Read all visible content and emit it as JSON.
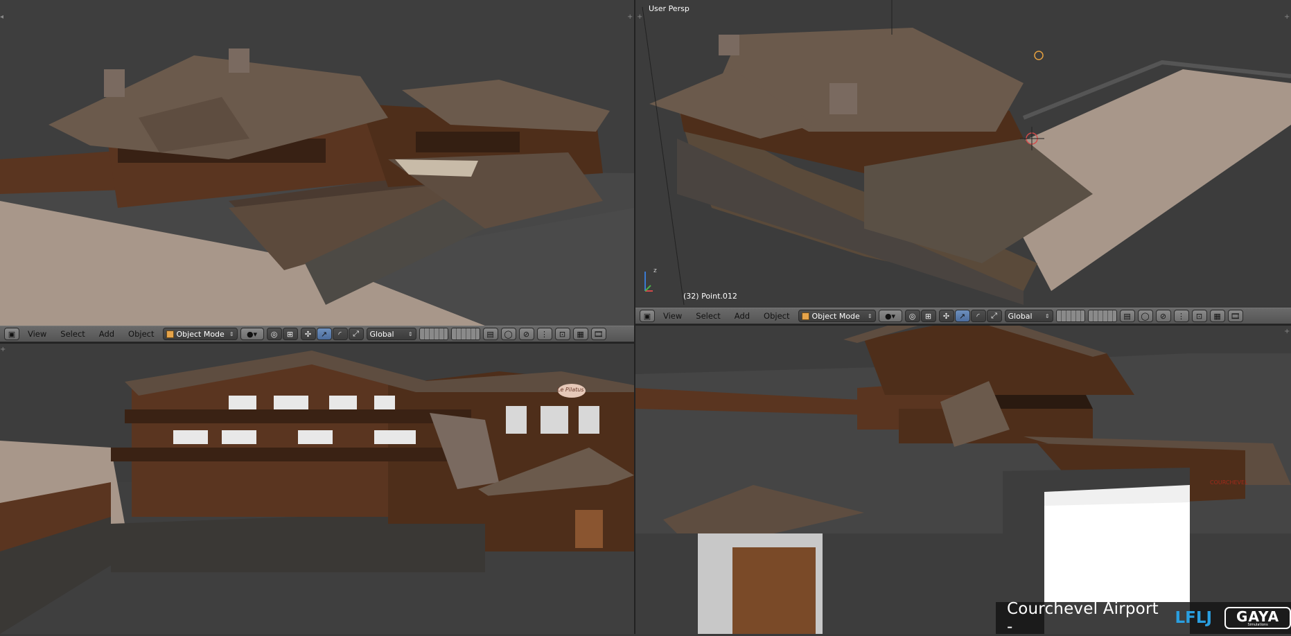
{
  "viewports": {
    "top_left": {
      "name": ""
    },
    "top_right": {
      "label": "User Persp",
      "object_info": "(32) Point.012"
    },
    "bottom_left": {
      "name": ""
    },
    "bottom_right": {
      "name": ""
    }
  },
  "header": {
    "menus": [
      "View",
      "Select",
      "Add",
      "Object"
    ],
    "mode": "Object Mode",
    "orientation": "Global"
  },
  "axis": {
    "z_label": "z"
  },
  "overlay": {
    "title": "Courchevel Airport -",
    "code": "LFLJ",
    "logo": "GAYA",
    "logo_sub": "Simulations"
  },
  "signs": {
    "restaurant": "Le Pilatus",
    "courchevel": "COURCHEVEL"
  },
  "colors": {
    "accent": "#2a9fe0",
    "active_button": "#5a7db0",
    "wood": "#5a3520",
    "roof": "#6b5a4c",
    "pavement": "#a8978a"
  }
}
